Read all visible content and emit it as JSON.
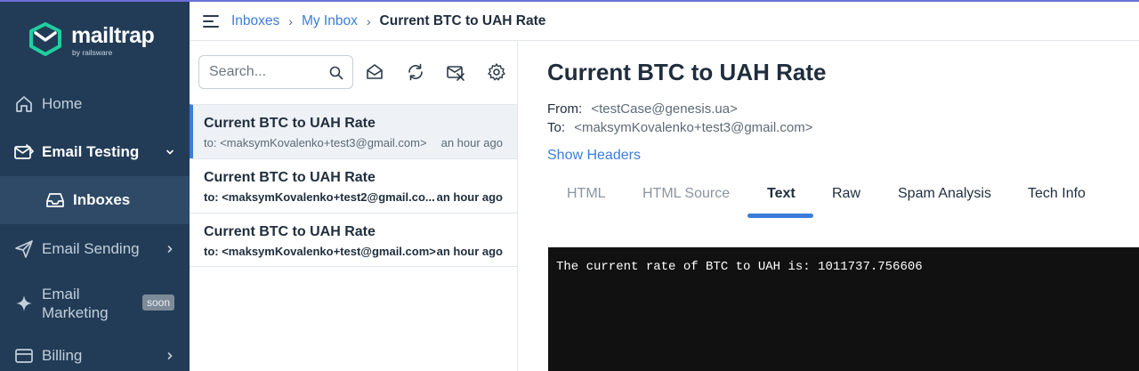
{
  "brand": {
    "name": "mailtrap",
    "tagline": "by railsware"
  },
  "sidebar": {
    "items": [
      {
        "label": "Home",
        "icon": "home-icon"
      },
      {
        "label": "Email Testing",
        "icon": "email-testing-icon"
      },
      {
        "label": "Inboxes",
        "icon": "inbox-icon"
      },
      {
        "label": "Email Sending",
        "icon": "send-icon"
      },
      {
        "label": "Email",
        "label2": "Marketing",
        "badge": "soon",
        "icon": "sparkle-icon"
      },
      {
        "label": "Billing",
        "icon": "billing-icon"
      }
    ]
  },
  "breadcrumb": {
    "items": [
      "Inboxes",
      "My Inbox"
    ],
    "current": "Current BTC to UAH Rate"
  },
  "search": {
    "placeholder": "Search..."
  },
  "messages": [
    {
      "subject": "Current BTC to UAH Rate",
      "to": "to: <maksymKovalenko+test3@gmail.com>",
      "time": "an hour ago",
      "selected": true
    },
    {
      "subject": "Current BTC to UAH Rate",
      "to": "to: <maksymKovalenko+test2@gmail.co...",
      "time": "an hour ago",
      "selected": false
    },
    {
      "subject": "Current BTC to UAH Rate",
      "to": "to: <maksymKovalenko+test@gmail.com>",
      "time": "an hour ago",
      "selected": false
    }
  ],
  "message": {
    "subject": "Current BTC to UAH Rate",
    "from_label": "From:",
    "from": "<testCase@genesis.ua>",
    "to_label": "To:",
    "to": "<maksymKovalenko+test3@gmail.com>",
    "show_headers": "Show Headers",
    "tabs": [
      "HTML",
      "HTML Source",
      "Text",
      "Raw",
      "Spam Analysis",
      "Tech Info"
    ],
    "active_tab": "Text",
    "body": "The current rate of BTC to UAH is: 1011737.756606"
  },
  "colors": {
    "sidebar": "#223c57",
    "accent": "#3b7dd8",
    "logo": "#1fcf9f"
  }
}
